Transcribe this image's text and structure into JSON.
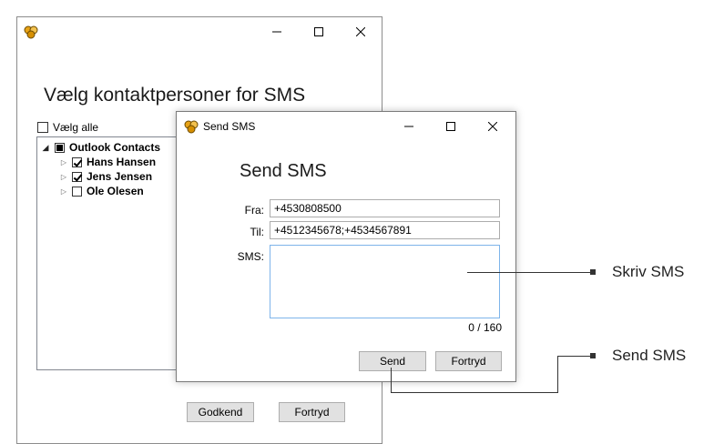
{
  "back_window": {
    "heading": "Vælg kontaktpersoner for SMS",
    "select_all_label": "Vælg alle",
    "tree": {
      "root_label": "Outlook Contacts",
      "contacts": [
        {
          "name": "Hans Hansen",
          "checked": true
        },
        {
          "name": "Jens Jensen",
          "checked": true
        },
        {
          "name": "Ole Olesen",
          "checked": false
        }
      ]
    },
    "ok_button": "Godkend",
    "cancel_button": "Fortryd"
  },
  "dialog": {
    "window_title": "Send SMS",
    "heading": "Send SMS",
    "from_label": "Fra:",
    "from_value": "+4530808500",
    "to_label": "Til:",
    "to_value": "+4512345678;+4534567891",
    "sms_label": "SMS:",
    "sms_value": "",
    "counter": "0 / 160",
    "send_button": "Send",
    "cancel_button": "Fortryd"
  },
  "callouts": {
    "write_sms": "Skriv SMS",
    "send_sms": "Send SMS"
  },
  "colors": {
    "button_bg": "#e1e1e1",
    "textarea_focus_border": "#7eb4ea",
    "app_icon": "#e8a317"
  }
}
